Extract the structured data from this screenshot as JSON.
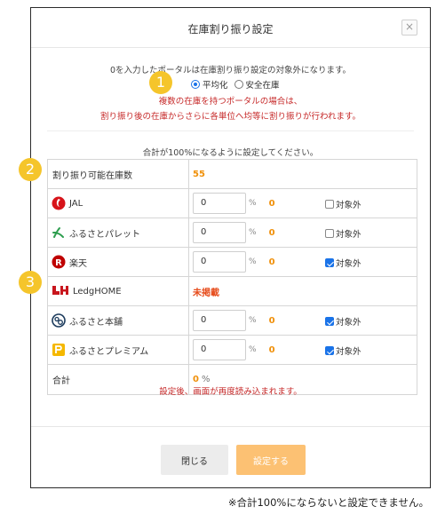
{
  "modal": {
    "title": "在庫割り振り設定",
    "close_label": "×",
    "notice_line1": "0を入力したポータルは在庫割り振り設定の対象外になります。",
    "radio_options": [
      {
        "label": "平均化",
        "checked": true
      },
      {
        "label": "安全在庫",
        "checked": false
      }
    ],
    "notice_line2": "複数の在庫を持つポータルの場合は、",
    "notice_line3": "割り振り後の在庫からさらに各単位へ均等に割り振りが行われます。",
    "notice_line4": "合計が100%になるように設定してください。",
    "allocatable": {
      "label": "割り振り可能在庫数",
      "value": "55"
    },
    "portals": [
      {
        "name": "JAL",
        "icon": "jal-logo-icon",
        "input": "0",
        "unit": "%",
        "count": "0",
        "exclude_label": "対象外",
        "excluded": false
      },
      {
        "name": "ふるさとパレット",
        "icon": "furusato-palette-logo-icon",
        "input": "0",
        "unit": "%",
        "count": "0",
        "exclude_label": "対象外",
        "excluded": false
      },
      {
        "name": "楽天",
        "icon": "rakuten-logo-icon",
        "input": "0",
        "unit": "%",
        "count": "0",
        "exclude_label": "対象外",
        "excluded": true
      },
      {
        "name": "LedgHOME",
        "icon": "ledghome-logo-icon",
        "status": "未掲載"
      },
      {
        "name": "ふるさと本舗",
        "icon": "furusato-honpo-logo-icon",
        "input": "0",
        "unit": "%",
        "count": "0",
        "exclude_label": "対象外",
        "excluded": true
      },
      {
        "name": "ふるさとプレミアム",
        "icon": "furusato-premium-logo-icon",
        "input": "0",
        "unit": "%",
        "count": "0",
        "exclude_label": "対象外",
        "excluded": true
      }
    ],
    "total": {
      "label": "合計",
      "value": "0",
      "unit": "%"
    },
    "reload_note": "設定後、画面が再度読み込まれます。",
    "buttons": {
      "close": "閉じる",
      "save": "設定する"
    }
  },
  "annotations": {
    "b1": "1",
    "b2": "2",
    "b3": "3"
  },
  "bottom_note": "※合計100%にならないと設定できません。",
  "colors": {
    "accent": "#f0900a",
    "warning": "#c62828",
    "badge": "#f5c52b",
    "save_button": "#fcc173"
  }
}
